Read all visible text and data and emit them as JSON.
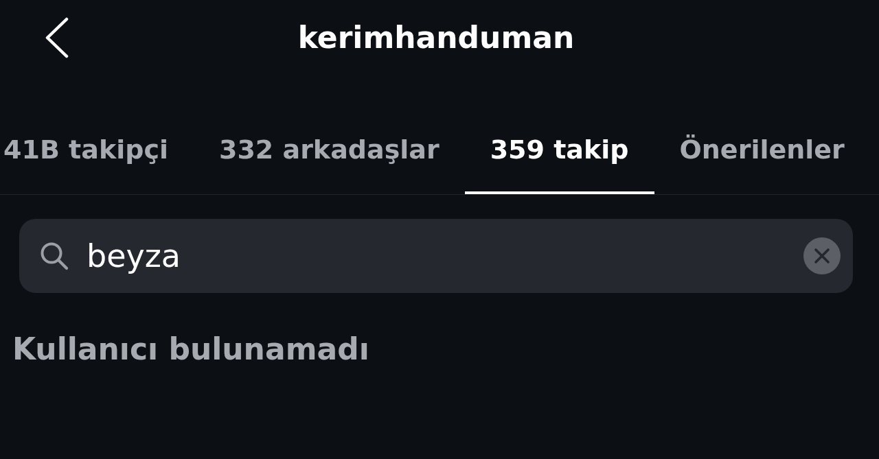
{
  "header": {
    "title": "kerimhanduman"
  },
  "tabs": [
    {
      "label": "41B takipçi",
      "selected": false
    },
    {
      "label": "332 arkadaşlar",
      "selected": false
    },
    {
      "label": "359 takip",
      "selected": true
    },
    {
      "label": "Önerilenler",
      "selected": false
    }
  ],
  "search": {
    "value": "beyza"
  },
  "empty_message": "Kullanıcı bulunamadı"
}
